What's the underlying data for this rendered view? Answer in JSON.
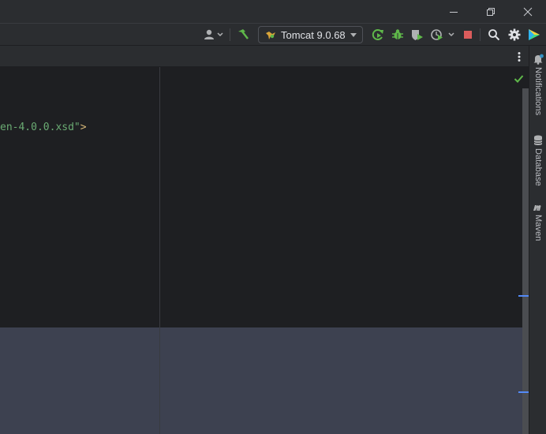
{
  "window": {
    "controls": [
      "minimize",
      "restore",
      "close"
    ]
  },
  "toolbar": {
    "run_config_label": "Tomcat 9.0.68",
    "icons": [
      "user-icon",
      "build-hammer-icon",
      "tomcat-icon",
      "rerun-icon",
      "debug-bug-icon",
      "coverage-icon",
      "profile-icon",
      "stop-icon",
      "search-icon",
      "settings-gear-icon",
      "jetbrains-logo"
    ],
    "colors": {
      "accent_green": "#5fb84a",
      "stop_red": "#db5c5c"
    }
  },
  "editor": {
    "code_string": "en-4.0.0.xsd\"",
    "code_tag_end": ">",
    "status": "no-problems-check"
  },
  "right_strip": {
    "items": [
      {
        "label": "Notifications",
        "icon": "bell-icon"
      },
      {
        "label": "Database",
        "icon": "database-icon"
      },
      {
        "label": "Maven",
        "icon": "maven-icon"
      }
    ]
  }
}
